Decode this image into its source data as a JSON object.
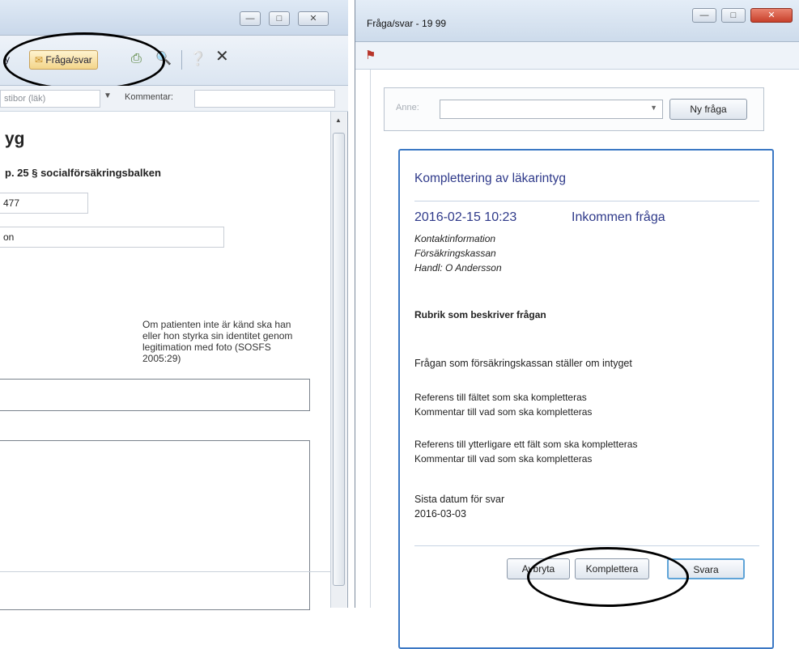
{
  "left": {
    "toolbar": {
      "partial_label": "y",
      "fraga_svar_label": "Fråga/svar"
    },
    "filter": {
      "partial_text": "stibor (läk)",
      "kommentar_label": "Kommentar:"
    },
    "content": {
      "heading_partial": "yg",
      "subheading_partial": "p. 25 § socialförsäkringsbalken",
      "field1_value": "477",
      "field2_value": "on",
      "note_text": "Om patienten inte är känd ska han eller hon styrka sin identitet genom legitimation med foto (SOSFS 2005:29)"
    }
  },
  "right": {
    "title": "Fråga/svar - 19 99",
    "anne_label": "Anne:",
    "ny_fraga_label": "Ny fråga",
    "card": {
      "title": "Komplettering av läkarintyg",
      "datetime": "2016-02-15 10:23",
      "status": "Inkommen fråga",
      "contact": [
        "Kontaktinformation",
        "Försäkringskassan",
        "Handl: O Andersson"
      ],
      "rubrik": "Rubrik som beskriver frågan",
      "question": "Frågan som försäkringskassan ställer om intyget",
      "ref1": [
        "Referens till fältet som ska kompletteras",
        "Kommentar till vad som ska kompletteras"
      ],
      "ref2": [
        "Referens till ytterligare ett fält som ska kompletteras",
        "Kommentar till vad som ska kompletteras"
      ],
      "deadline": [
        "Sista datum för svar",
        "2016-03-03"
      ],
      "buttons": {
        "avbryt": "Avbryta",
        "komplettera": "Komplettera",
        "svara": "Svara"
      }
    }
  },
  "colors": {
    "accent": "#3b78c4",
    "card_text": "#2f3a8a",
    "annotation": "#000000"
  }
}
